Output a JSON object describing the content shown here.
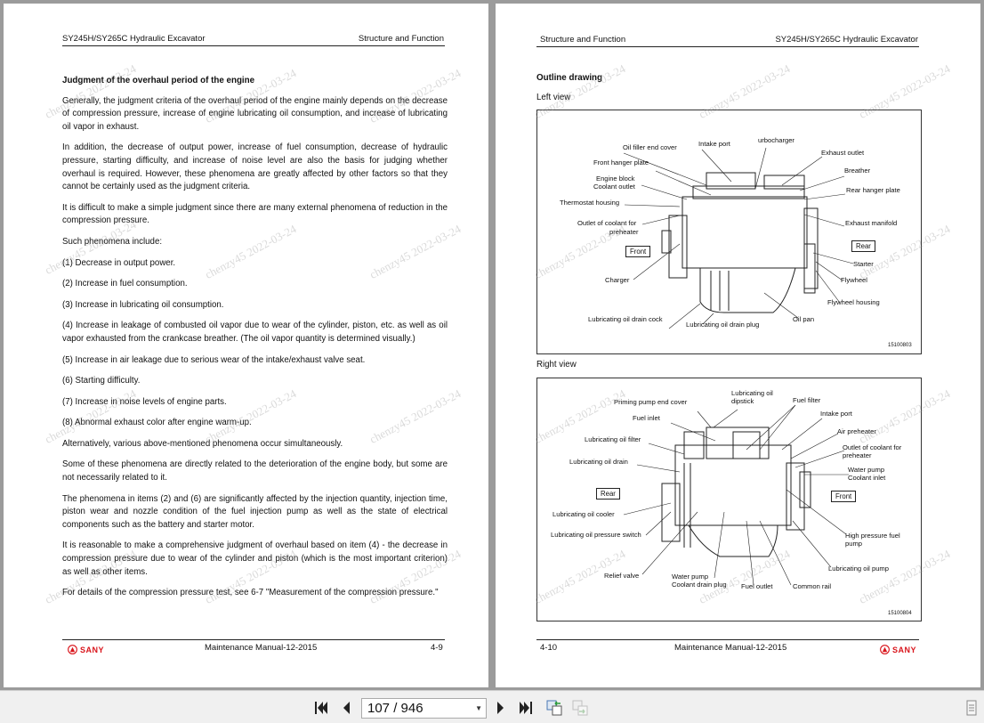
{
  "left_page": {
    "header_left": "SY245H/SY265C Hydraulic Excavator",
    "header_right": "Structure and Function",
    "heading": "Judgment of the overhaul period of the engine",
    "paragraphs": [
      "Generally, the judgment criteria of the overhaul period of the engine mainly depends on the decrease of compression pressure, increase of engine lubricating oil consumption, and increase of lubricating oil vapor in exhaust.",
      "In addition, the decrease of output power, increase of fuel consumption, decrease of hydraulic pressure, starting difficulty, and increase of noise level are also the basis for judging whether overhaul is required. However, these phenomena are greatly affected by other factors so that they cannot be certainly used as the judgment criteria.",
      "It is difficult to make a simple judgment since there are many external phenomena of reduction in the compression pressure.",
      "Such phenomena include:",
      "(1) Decrease in output power.",
      "(2) Increase in fuel consumption.",
      "(3) Increase in lubricating oil consumption.",
      "(4) Increase in leakage of combusted oil vapor due to wear of the cylinder, piston, etc. as well as oil vapor exhausted from the crankcase breather. (The oil vapor quantity is determined visually.)",
      "(5) Increase in air leakage due to serious wear of the intake/exhaust valve seat.",
      "(6) Starting difficulty.",
      "(7) Increase in noise levels of engine parts.",
      "(8) Abnormal exhaust color after engine warm-up.",
      "Alternatively, various above-mentioned phenomena occur simultaneously.",
      "Some of these phenomena are directly related to the deterioration of the engine body, but some are not necessarily related to it.",
      "The phenomena in items (2) and (6) are significantly affected by the injection quantity, injection time, piston wear and nozzle condition of the fuel injection pump as well as the state of electrical components such as the battery and starter motor.",
      "It is reasonable to make a comprehensive judgment of overhaul based on item (4) - the decrease in compression pressure due to wear of the cylinder and piston (which is the most important criterion) as well as other items.",
      "For details of the compression pressure test, see 6-7 \"Measurement of the compression pressure.\""
    ],
    "footer_logo": "SANY",
    "footer_center": "Maintenance Manual-12-2015",
    "page_number": "4-9"
  },
  "right_page": {
    "header_left": "Structure and Function",
    "header_right": "SY245H/SY265C Hydraulic Excavator",
    "heading": "Outline drawing",
    "left_view": {
      "title": "Left view",
      "labels": [
        "Oil filler end cover",
        "Intake port",
        "urbocharger",
        "Exhaust outlet",
        "Breather",
        "Rear hanger plate",
        "Front hanger plate",
        "Engine block",
        "Coolant outlet",
        "Thermostat housing",
        "Outlet of coolant for",
        "preheater",
        "Exhaust manifold",
        "Front",
        "Rear",
        "Starter",
        "Charger",
        "Flywheel",
        "Flywheel housing",
        "Lubricating oil drain cock",
        "Lubricating oil drain plug",
        "Oil pan"
      ],
      "figure_number": "15100803"
    },
    "right_view": {
      "title": "Right view",
      "labels": [
        "Lubricating oil",
        "dipstick",
        "Priming pump end cover",
        "Fuel filter",
        "Fuel inlet",
        "Intake port",
        "Air preheater",
        "Lubricating oil filter",
        "Outlet of coolant for",
        "preheater",
        "Lubricating oil drain",
        "Water pump",
        "Coolant inlet",
        "Rear",
        "Front",
        "Lubricating oil cooler",
        "Lubricating oil pressure switch",
        "High pressure fuel",
        "pump",
        "Lubricating oil pump",
        "Relief valve",
        "Water pump",
        "Coolant drain plug",
        "Fuel outlet",
        "Common rail"
      ],
      "figure_number": "15100804"
    },
    "footer_logo": "SANY",
    "footer_center": "Maintenance Manual-12-2015",
    "page_number": "4-10"
  },
  "watermark": "chenzy45 2022-03-24",
  "toolbar": {
    "page_display": "107 / 946"
  },
  "colors": {
    "brand": "#d9141b",
    "background": "#9b9b9b",
    "toolbar": "#f0f0f0"
  }
}
